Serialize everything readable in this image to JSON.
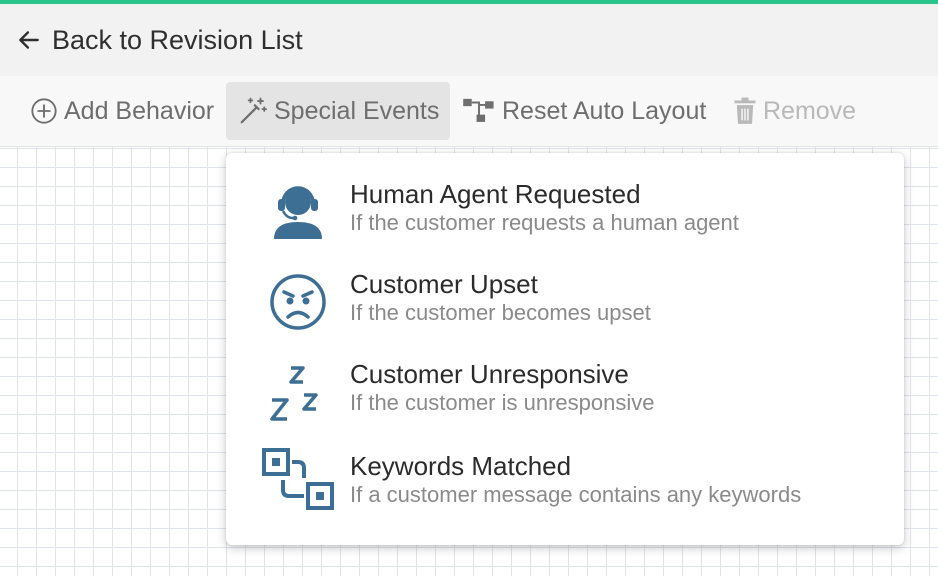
{
  "colors": {
    "accent_bar": "#2bc48a",
    "icon_blue": "#3d6e94",
    "header_bg": "#f2f2f2",
    "toolbar_bg": "#f8f8f8"
  },
  "header": {
    "back_label": "Back to Revision List",
    "back_icon": "arrow-left-icon"
  },
  "toolbar": {
    "add_behavior": {
      "label": "Add Behavior",
      "icon": "plus-circle-icon"
    },
    "special_events": {
      "label": "Special Events",
      "icon": "magic-wand-icon",
      "active": true
    },
    "reset_layout": {
      "label": "Reset Auto Layout",
      "icon": "hierarchy-icon"
    },
    "remove": {
      "label": "Remove",
      "icon": "trash-icon",
      "disabled": true
    }
  },
  "special_events_menu": {
    "items": [
      {
        "title": "Human Agent Requested",
        "description": "If the customer requests a human agent",
        "icon": "headset-agent-icon"
      },
      {
        "title": "Customer Upset",
        "description": "If the customer becomes upset",
        "icon": "angry-face-icon"
      },
      {
        "title": "Customer Unresponsive",
        "description": "If the customer is unresponsive",
        "icon": "sleep-zzz-icon"
      },
      {
        "title": "Keywords Matched",
        "description": "If a customer message contains any keywords",
        "icon": "keyword-link-icon"
      }
    ]
  }
}
